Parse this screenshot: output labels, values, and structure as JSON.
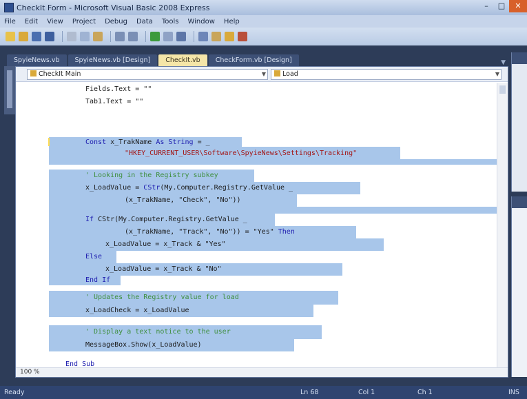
{
  "window": {
    "title": "CheckIt Form - Microsoft Visual Basic 2008 Express"
  },
  "menu": [
    "File",
    "Edit",
    "View",
    "Project",
    "Debug",
    "Data",
    "Tools",
    "Window",
    "Help"
  ],
  "tabs": [
    {
      "label": "SpyieNews.vb"
    },
    {
      "label": "SpyieNews.vb [Design]"
    },
    {
      "label": "CheckIt.vb",
      "active": true
    },
    {
      "label": "CheckForm.vb [Design]"
    }
  ],
  "nav": {
    "left_combo": "CheckIt Main",
    "right_combo": "Load"
  },
  "code_lines": [
    [
      {
        "t": "Fields.Text = \"\"",
        "c": ""
      }
    ],
    [
      {
        "t": "Tab1.Text = \"\"",
        "c": ""
      }
    ],
    [
      {
        "t": "Const ",
        "c": "kw"
      },
      {
        "t": "x_TrakName ",
        "c": ""
      },
      {
        "t": "As String",
        "c": "kw"
      },
      {
        "t": " = _",
        "c": ""
      }
    ],
    [
      {
        "t": "\"HKEY_CURRENT_USER\\Software\\SpyieNews\\Settings\\Tracking\"",
        "c": "str"
      }
    ],
    [
      {
        "t": "",
        "c": ""
      }
    ],
    [
      {
        "t": "' Looking in the Registry subkey",
        "c": "cm"
      }
    ],
    [
      {
        "t": "x_LoadValue = ",
        "c": ""
      },
      {
        "t": "CStr",
        "c": "kw"
      },
      {
        "t": "(My.Computer.Registry.GetValue _",
        "c": ""
      }
    ],
    [
      {
        "t": "(x_TrakName, \"Check\", \"No\"))",
        "c": ""
      }
    ],
    [
      {
        "t": "",
        "c": ""
      }
    ],
    [
      {
        "t": "If ",
        "c": "kw"
      },
      {
        "t": "CStr(My.Computer.Registry.GetValue _",
        "c": ""
      }
    ],
    [
      {
        "t": "(x_TrakName, \"Track\", \"No\")) = \"Yes\" ",
        "c": ""
      },
      {
        "t": "Then",
        "c": "kw"
      }
    ],
    [
      {
        "t": "x_LoadValue = x_Track & \"Yes\"",
        "c": ""
      }
    ],
    [
      {
        "t": "Else",
        "c": "kw"
      }
    ],
    [
      {
        "t": "x_LoadValue = x_Track & \"No\"",
        "c": ""
      }
    ],
    [
      {
        "t": "End If",
        "c": "kw"
      }
    ],
    [
      {
        "t": "",
        "c": ""
      }
    ],
    [
      {
        "t": "' Updates the Registry value for load",
        "c": "cm"
      }
    ],
    [
      {
        "t": "x_LoadCheck = x_LoadValue",
        "c": ""
      }
    ],
    [
      {
        "t": "",
        "c": ""
      }
    ],
    [
      {
        "t": "' Display a text notice to the user",
        "c": "cm"
      }
    ],
    [
      {
        "t": "MessageBox.Show(x_LoadValue)",
        "c": ""
      }
    ],
    [
      {
        "t": "",
        "c": ""
      }
    ],
    [
      {
        "t": "End Sub",
        "c": "kw"
      }
    ]
  ],
  "editor": {
    "zoom": "100 %"
  },
  "status": {
    "left": "Ready",
    "ln": "Ln 68",
    "col": "Col 1",
    "ch": "Ch 1",
    "ins": "INS"
  }
}
